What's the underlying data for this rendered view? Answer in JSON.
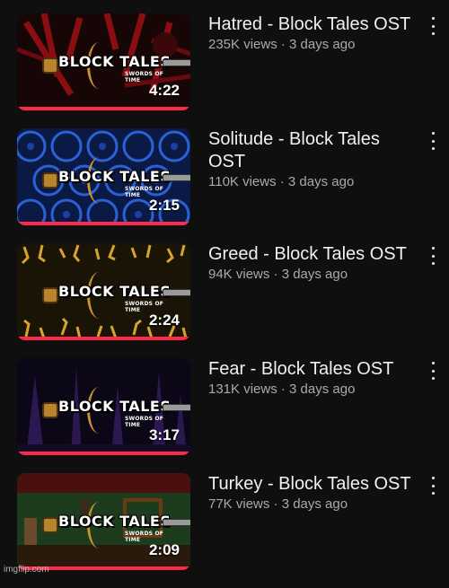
{
  "videos": [
    {
      "title": "Hatred - Block Tales OST",
      "meta": "235K views · 3 days ago",
      "duration": "4:22",
      "logo_text": "BLOCK TALES",
      "logo_sub": "SWORDS OF TIME",
      "theme": "red"
    },
    {
      "title": "Solitude - Block Tales OST",
      "meta": "110K views · 3 days ago",
      "duration": "2:15",
      "logo_text": "BLOCK TALES",
      "logo_sub": "SWORDS OF TIME",
      "theme": "blue"
    },
    {
      "title": "Greed - Block Tales OST",
      "meta": "94K views · 3 days ago",
      "duration": "2:24",
      "logo_text": "BLOCK TALES",
      "logo_sub": "SWORDS OF TIME",
      "theme": "gold"
    },
    {
      "title": "Fear - Block Tales OST",
      "meta": "131K views · 3 days ago",
      "duration": "3:17",
      "logo_text": "BLOCK TALES",
      "logo_sub": "SWORDS OF TIME",
      "theme": "purple"
    },
    {
      "title": "Turkey - Block Tales OST",
      "meta": "77K views · 3 days ago",
      "duration": "2:09",
      "logo_text": "BLOCK TALES",
      "logo_sub": "SWORDS OF TIME",
      "theme": "green"
    }
  ],
  "watermark": "imgflip.com",
  "colors": {
    "background": "#0f0f0f",
    "title": "#f1f1f1",
    "meta": "#aaaaaa",
    "progress": "#ff2a4a"
  },
  "icons": {
    "menu": "more-vertical-icon"
  }
}
